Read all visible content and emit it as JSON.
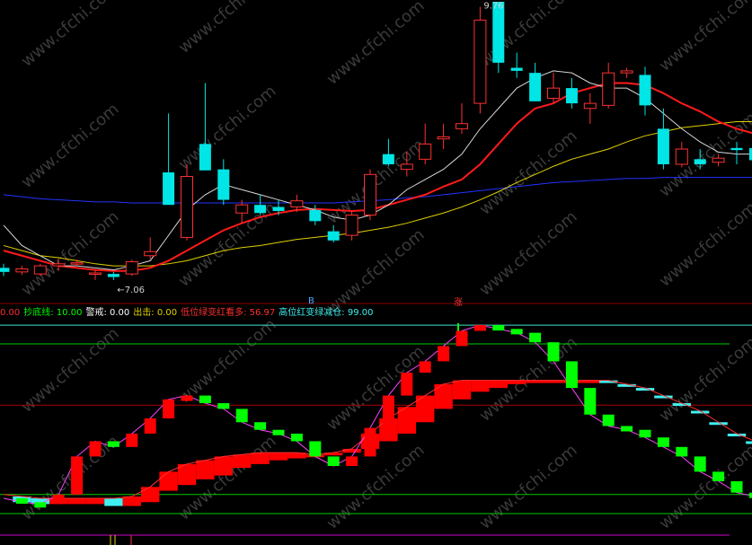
{
  "colors": {
    "up": "#ff3030",
    "down": "#00e5e5",
    "ma5": "#d8d8d8",
    "ma10": "#ff1a1a",
    "ma20": "#e0d000",
    "ma60": "#2233ff",
    "grid_red": "#8b0000",
    "osc_up": "#ff0000",
    "osc_down": "#00ff00",
    "band_up": "#ff0000",
    "band_down": "#40f0f0",
    "osc_line": "#ff40ff"
  },
  "watermark": "www.cfchi.com",
  "header_tokens": {
    "left_mark": "B",
    "right_mark": "涨"
  },
  "legend": [
    {
      "label": "0.00",
      "color": "#ff3030"
    },
    {
      "label": "抄底线:",
      "value": "10.00",
      "color": "#00ff00"
    },
    {
      "label": "警戒:",
      "value": "0.00",
      "color": "#ffffff"
    },
    {
      "label": "出击:",
      "value": "0.00",
      "color": "#e0d000"
    },
    {
      "label": "低位绿变红看多:",
      "value": "56.97",
      "color": "#ff3030"
    },
    {
      "label": "高位红变绿减仓:",
      "value": "99.00",
      "color": "#40f0f0"
    }
  ],
  "chart_data": [
    {
      "type": "candlestick",
      "title": "",
      "annotations": [
        {
          "text": "9.76",
          "at": "high",
          "index": 26
        },
        {
          "text": "←7.06",
          "at": "low",
          "index": 6
        }
      ],
      "price_range": [
        6.9,
        9.8
      ],
      "candles": [
        {
          "o": 7.18,
          "h": 7.22,
          "l": 7.1,
          "c": 7.14
        },
        {
          "o": 7.14,
          "h": 7.2,
          "l": 7.11,
          "c": 7.17
        },
        {
          "o": 7.12,
          "h": 7.22,
          "l": 7.1,
          "c": 7.2
        },
        {
          "o": 7.2,
          "h": 7.26,
          "l": 7.15,
          "c": 7.22
        },
        {
          "o": 7.22,
          "h": 7.26,
          "l": 7.2,
          "c": 7.23
        },
        {
          "o": 7.13,
          "h": 7.16,
          "l": 7.06,
          "c": 7.13
        },
        {
          "o": 7.12,
          "h": 7.14,
          "l": 7.06,
          "c": 7.09
        },
        {
          "o": 7.12,
          "h": 7.26,
          "l": 7.1,
          "c": 7.24
        },
        {
          "o": 7.3,
          "h": 7.48,
          "l": 7.26,
          "c": 7.34
        },
        {
          "o": 8.12,
          "h": 8.7,
          "l": 8.02,
          "c": 7.8
        },
        {
          "o": 7.48,
          "h": 8.2,
          "l": 7.45,
          "c": 8.08
        },
        {
          "o": 8.4,
          "h": 9.0,
          "l": 8.2,
          "c": 8.14
        },
        {
          "o": 8.15,
          "h": 8.25,
          "l": 7.8,
          "c": 7.85
        },
        {
          "o": 7.72,
          "h": 7.85,
          "l": 7.62,
          "c": 7.8
        },
        {
          "o": 7.8,
          "h": 7.9,
          "l": 7.7,
          "c": 7.72
        },
        {
          "o": 7.78,
          "h": 7.85,
          "l": 7.7,
          "c": 7.74
        },
        {
          "o": 7.78,
          "h": 7.9,
          "l": 7.73,
          "c": 7.84
        },
        {
          "o": 7.75,
          "h": 7.8,
          "l": 7.6,
          "c": 7.64
        },
        {
          "o": 7.54,
          "h": 7.6,
          "l": 7.43,
          "c": 7.45
        },
        {
          "o": 7.5,
          "h": 7.74,
          "l": 7.45,
          "c": 7.7
        },
        {
          "o": 7.7,
          "h": 8.15,
          "l": 7.65,
          "c": 8.1
        },
        {
          "o": 8.3,
          "h": 8.45,
          "l": 8.18,
          "c": 8.2
        },
        {
          "o": 8.15,
          "h": 8.33,
          "l": 8.08,
          "c": 8.2
        },
        {
          "o": 8.25,
          "h": 8.6,
          "l": 8.2,
          "c": 8.4
        },
        {
          "o": 8.45,
          "h": 8.6,
          "l": 8.35,
          "c": 8.47
        },
        {
          "o": 8.55,
          "h": 8.8,
          "l": 8.5,
          "c": 8.6
        },
        {
          "o": 8.8,
          "h": 9.75,
          "l": 8.7,
          "c": 9.62
        },
        {
          "o": 9.8,
          "h": 9.76,
          "l": 9.1,
          "c": 9.2
        },
        {
          "o": 9.15,
          "h": 9.3,
          "l": 9.05,
          "c": 9.12
        },
        {
          "o": 9.1,
          "h": 9.2,
          "l": 8.82,
          "c": 8.82
        },
        {
          "o": 8.85,
          "h": 9.1,
          "l": 8.8,
          "c": 8.95
        },
        {
          "o": 8.95,
          "h": 9.05,
          "l": 8.75,
          "c": 8.8
        },
        {
          "o": 8.75,
          "h": 8.9,
          "l": 8.6,
          "c": 8.8
        },
        {
          "o": 8.78,
          "h": 9.2,
          "l": 8.75,
          "c": 9.1
        },
        {
          "o": 9.1,
          "h": 9.15,
          "l": 9.05,
          "c": 9.12
        },
        {
          "o": 9.08,
          "h": 9.16,
          "l": 8.68,
          "c": 8.78
        },
        {
          "o": 8.55,
          "h": 8.75,
          "l": 8.15,
          "c": 8.2
        },
        {
          "o": 8.2,
          "h": 8.42,
          "l": 8.17,
          "c": 8.35
        },
        {
          "o": 8.25,
          "h": 8.35,
          "l": 8.15,
          "c": 8.2
        },
        {
          "o": 8.22,
          "h": 8.3,
          "l": 8.18,
          "c": 8.26
        },
        {
          "o": 8.36,
          "h": 8.42,
          "l": 8.2,
          "c": 8.34
        },
        {
          "o": 8.36,
          "h": 8.42,
          "l": 8.14,
          "c": 8.24
        }
      ],
      "ma5": [
        7.6,
        7.4,
        7.3,
        7.2,
        7.2,
        7.18,
        7.16,
        7.2,
        7.25,
        7.5,
        7.75,
        7.9,
        8.0,
        7.95,
        7.9,
        7.85,
        7.8,
        7.75,
        7.68,
        7.65,
        7.7,
        7.8,
        7.95,
        8.05,
        8.15,
        8.3,
        8.55,
        8.75,
        8.95,
        9.05,
        9.12,
        9.1,
        9.0,
        8.95,
        8.95,
        8.85,
        8.7,
        8.55,
        8.42,
        8.32,
        8.3,
        8.3
      ],
      "ma10": [
        7.35,
        7.3,
        7.25,
        7.2,
        7.18,
        7.16,
        7.15,
        7.15,
        7.18,
        7.25,
        7.35,
        7.45,
        7.55,
        7.62,
        7.68,
        7.72,
        7.75,
        7.76,
        7.75,
        7.74,
        7.75,
        7.8,
        7.85,
        7.9,
        7.98,
        8.05,
        8.2,
        8.4,
        8.6,
        8.75,
        8.8,
        8.9,
        8.95,
        9.0,
        9.0,
        8.98,
        8.9,
        8.8,
        8.72,
        8.62,
        8.55,
        8.5
      ],
      "ma20": [
        7.4,
        7.35,
        7.3,
        7.28,
        7.25,
        7.22,
        7.2,
        7.2,
        7.2,
        7.22,
        7.25,
        7.3,
        7.35,
        7.38,
        7.4,
        7.43,
        7.46,
        7.48,
        7.5,
        7.52,
        7.55,
        7.58,
        7.62,
        7.67,
        7.72,
        7.78,
        7.85,
        7.93,
        8.02,
        8.1,
        8.18,
        8.25,
        8.3,
        8.35,
        8.42,
        8.48,
        8.52,
        8.56,
        8.58,
        8.6,
        8.62,
        8.62
      ],
      "ma60": [
        7.9,
        7.88,
        7.86,
        7.85,
        7.84,
        7.83,
        7.83,
        7.82,
        7.82,
        7.82,
        7.82,
        7.82,
        7.82,
        7.82,
        7.82,
        7.82,
        7.82,
        7.82,
        7.82,
        7.83,
        7.84,
        7.85,
        7.87,
        7.88,
        7.9,
        7.92,
        7.94,
        7.96,
        7.98,
        8.0,
        8.02,
        8.03,
        8.04,
        8.05,
        8.06,
        8.06,
        8.07,
        8.07,
        8.07,
        8.07,
        8.07,
        8.07
      ]
    },
    {
      "type": "bar",
      "title": "",
      "ylim": [
        0,
        100
      ],
      "reference_lines": [
        99,
        56.97,
        10,
        0
      ],
      "osc": [
        8,
        6,
        5,
        10,
        30,
        38,
        35,
        42,
        50,
        60,
        62,
        58,
        55,
        48,
        44,
        42,
        38,
        30,
        25,
        30,
        45,
        62,
        74,
        80,
        88,
        96,
        99,
        97,
        95,
        90,
        80,
        66,
        52,
        46,
        44,
        40,
        35,
        30,
        22,
        17,
        11,
        9
      ],
      "band_low": [
        8,
        6,
        5,
        5,
        5,
        5,
        4,
        4,
        6,
        12,
        15,
        18,
        20,
        24,
        26,
        28,
        29,
        30,
        31,
        32,
        34,
        38,
        42,
        48,
        55,
        60,
        64,
        66,
        68,
        70,
        70,
        70,
        70,
        69,
        68,
        66,
        62,
        58,
        54,
        48,
        42,
        38
      ],
      "band_high": [
        10,
        9,
        8,
        8,
        8,
        8,
        8,
        9,
        14,
        22,
        26,
        28,
        30,
        31,
        32,
        32,
        32,
        31,
        32,
        34,
        42,
        50,
        56,
        62,
        68,
        70,
        70,
        70,
        70,
        70,
        70,
        70,
        70,
        70,
        68,
        66,
        62,
        58,
        54,
        48,
        42,
        38
      ]
    }
  ]
}
